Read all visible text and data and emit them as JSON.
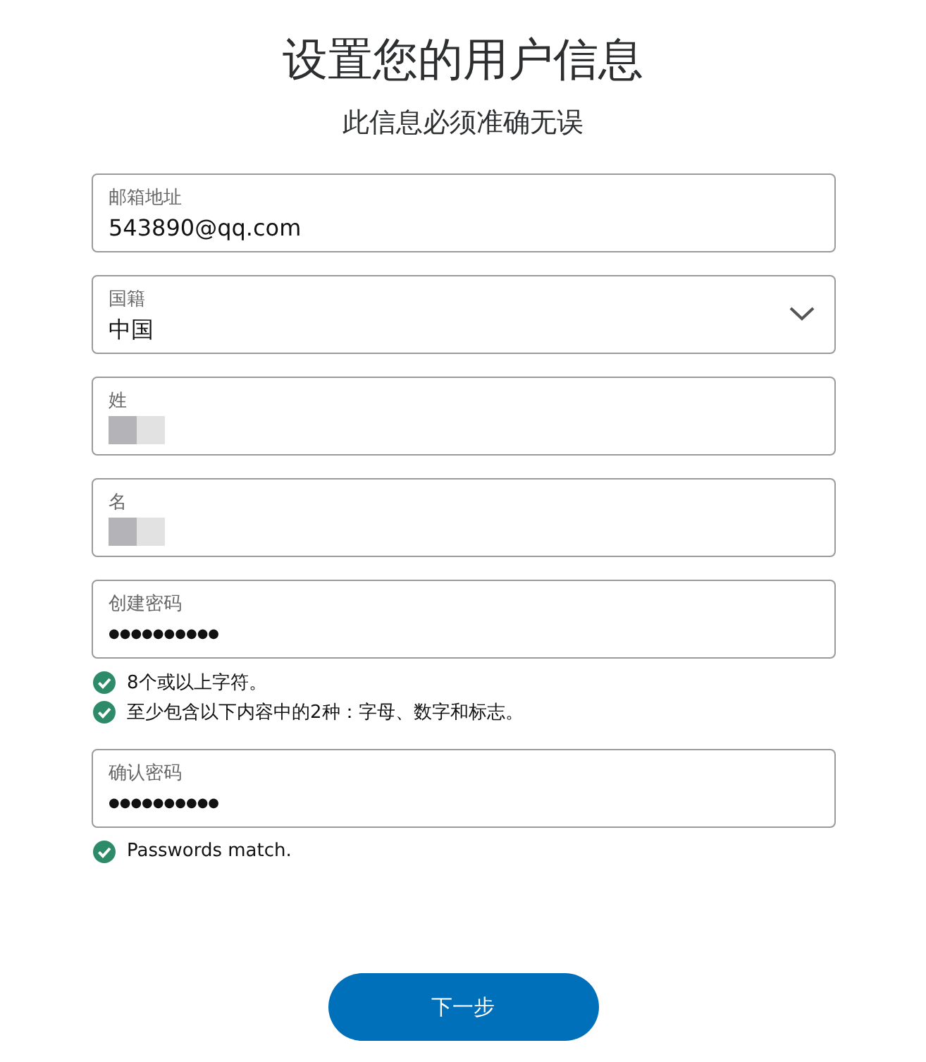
{
  "title": "设置您的用户信息",
  "subtitle": "此信息必须准确无误",
  "fields": [
    {
      "kind": "text",
      "label": "邮箱地址",
      "value": "543890@qq.com",
      "redacted": false
    },
    {
      "kind": "select",
      "label": "国籍",
      "value": "中国",
      "redacted": false
    },
    {
      "kind": "text",
      "label": "姓",
      "redacted": true
    },
    {
      "kind": "text",
      "label": "名",
      "redacted": true
    },
    {
      "kind": "password",
      "label": "创建密码",
      "value": "●●●●●●●●●●",
      "redacted": false,
      "checks": [
        {
          "text": "8个或以上字符。",
          "met": true
        },
        {
          "text": "至少包含以下内容中的2种：字母、数字和标志。",
          "met": true
        }
      ]
    },
    {
      "kind": "password",
      "label": "确认密码",
      "value": "●●●●●●●●●●",
      "redacted": false,
      "checks": [
        {
          "text": "Passwords match.",
          "met": true
        }
      ]
    }
  ],
  "button": "下一步"
}
